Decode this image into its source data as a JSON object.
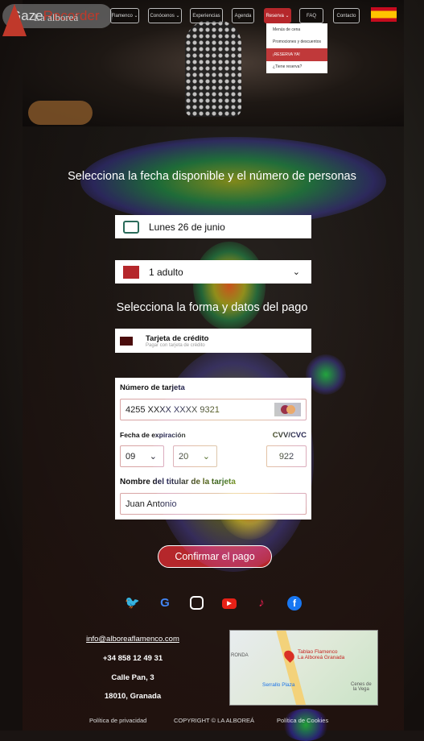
{
  "overlay": {
    "brand": "GazeRecorder",
    "brand_a": "Gaze",
    "brand_b": "Recorder"
  },
  "logo": {
    "text": "La alboreá"
  },
  "nav": {
    "items": [
      "Flamenco ⌄",
      "Conócenos ⌄",
      "Experiencias",
      "Agenda",
      "Reserva ⌄",
      "FAQ",
      "Contacto"
    ],
    "active": "Reserva ⌄",
    "dropdown": [
      "Menús de cena",
      "Promociones y descuentos",
      "¡RESERVA YA!",
      "¿Tiene reserva?"
    ],
    "dropdown_active": "¡RESERVA YA!",
    "language": "ES"
  },
  "booking": {
    "title": "Selecciona la fecha disponible y el número de personas",
    "date": "Lunes 26 de junio",
    "people": "1 adulto"
  },
  "payment": {
    "title": "Selecciona la forma y datos del pago",
    "method_title": "Tarjeta de crédito",
    "method_subtitle": "Pagar con tarjeta de crédito",
    "card_number_label": "Número de tarjeta",
    "card_number": "4255 XXXX XXXX 9321",
    "card_brand": "MasterCard",
    "expiry_label": "Fecha de expiración",
    "expiry_month": "09",
    "expiry_year": "20",
    "cvv_label": "CVV/CVC",
    "cvv": "922",
    "holder_label": "Nombre del titular de la tarjeta",
    "holder": "Juan Antonio",
    "confirm": "Confirmar el pago"
  },
  "social": [
    "twitter",
    "google",
    "instagram",
    "youtube",
    "tiktok",
    "facebook"
  ],
  "footer": {
    "email": "info@alboreaflamenco.com",
    "phone": "+34 858 12 49 31",
    "street": "Calle Pan, 3",
    "city": "18010, Granada",
    "map": {
      "place": "Tablao Flamenco La Alboreá Granada",
      "l1": "Tablao Flamenco",
      "l2": "La Alboreá Granada",
      "plaza": "Serrallo Plaza",
      "town1": "Cenes de",
      "town2": "la Vega",
      "area": "RONDA"
    },
    "links": [
      "Política de privacidad",
      "COPYRIGHT © LA ALBOREÁ",
      "Política de Cookies"
    ]
  },
  "colors": {
    "accent": "#b5272b"
  }
}
